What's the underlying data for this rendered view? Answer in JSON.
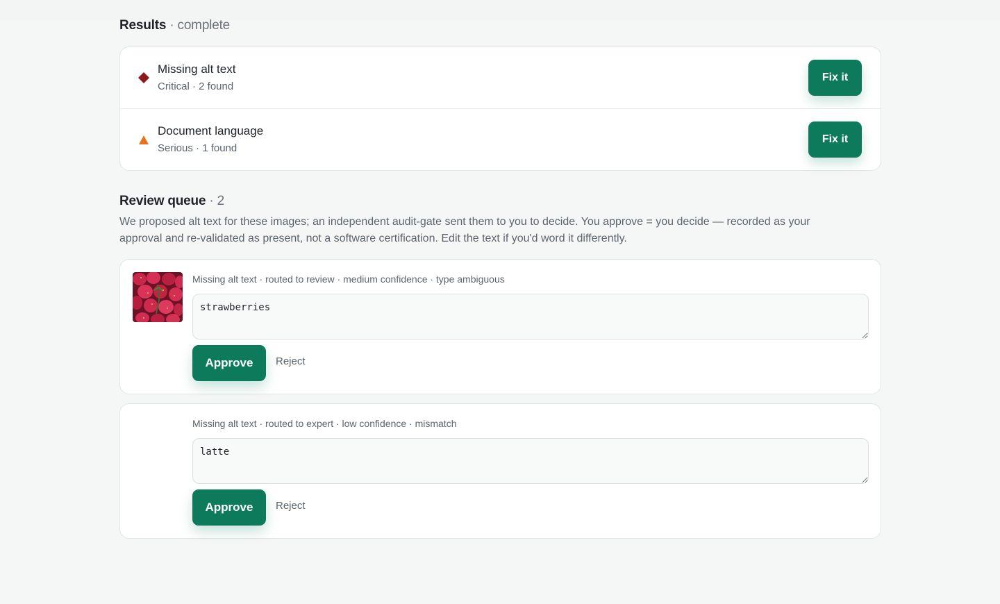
{
  "results": {
    "title": "Results",
    "status": " · complete",
    "items": [
      {
        "name": "Missing alt text",
        "meta": "Critical · 2 found",
        "severity_color": "#8b1a1a",
        "icon": "diamond-icon",
        "action": "Fix it"
      },
      {
        "name": "Document language",
        "meta": "Serious · 1 found",
        "severity_color": "#e8731a",
        "icon": "triangle-icon",
        "action": "Fix it"
      }
    ]
  },
  "queue": {
    "title": "Review queue",
    "count": " · 2",
    "description": "We proposed alt text for these images; an independent audit-gate sent them to you to decide. You approve = you decide — recorded as your approval and re-validated as present, not a software certification. Edit the text if you'd word it differently.",
    "items": [
      {
        "meta": "Missing alt text · routed to review · medium confidence · type ambiguous",
        "text": "strawberries",
        "approve": "Approve",
        "reject": "Reject",
        "thumbnail": "strawberries-image"
      },
      {
        "meta": "Missing alt text · routed to expert · low confidence · mismatch",
        "text": "latte",
        "approve": "Approve",
        "reject": "Reject"
      }
    ]
  },
  "colors": {
    "accent": "#0d7a5c",
    "critical": "#8b1a1a",
    "serious": "#e8731a"
  }
}
